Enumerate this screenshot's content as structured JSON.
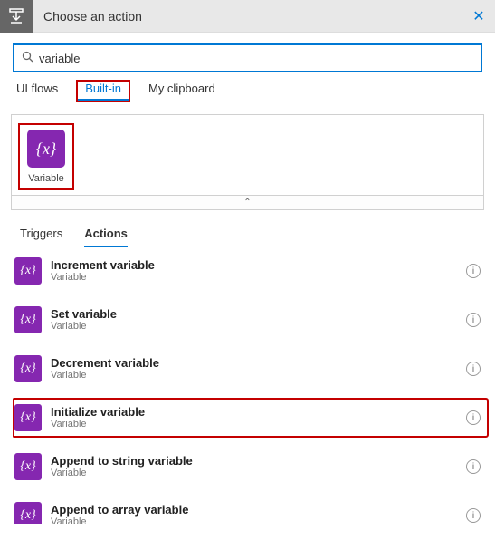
{
  "header": {
    "title": "Choose an action"
  },
  "search": {
    "value": "variable",
    "placeholder": "Search connectors and actions"
  },
  "connectorTabs": {
    "items": [
      {
        "label": "UI flows",
        "active": false
      },
      {
        "label": "Built-in",
        "active": true
      },
      {
        "label": "My clipboard",
        "active": false
      }
    ]
  },
  "connector": {
    "label": "Variable",
    "iconGlyph": "{x}",
    "iconName": "variable-icon"
  },
  "taTabs": {
    "items": [
      {
        "label": "Triggers",
        "active": false
      },
      {
        "label": "Actions",
        "active": true
      }
    ]
  },
  "actions": [
    {
      "name": "Increment variable",
      "sub": "Variable",
      "highlight": false
    },
    {
      "name": "Set variable",
      "sub": "Variable",
      "highlight": false
    },
    {
      "name": "Decrement variable",
      "sub": "Variable",
      "highlight": false
    },
    {
      "name": "Initialize variable",
      "sub": "Variable",
      "highlight": true
    },
    {
      "name": "Append to string variable",
      "sub": "Variable",
      "highlight": false
    },
    {
      "name": "Append to array variable",
      "sub": "Variable",
      "highlight": false
    }
  ]
}
